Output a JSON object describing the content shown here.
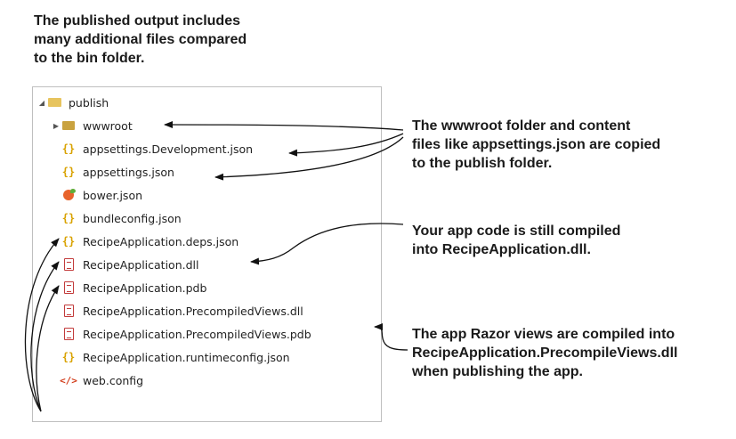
{
  "callouts": {
    "top": "The published output includes\nmany additional files compared\nto the bin folder.",
    "wwwroot": "The wwwroot folder and content\nfiles like appsettings.json are copied\nto the publish folder.",
    "app_code": "Your app code is still compiled\ninto RecipeApplication.dll.",
    "razor": "The app Razor views are compiled into\nRecipeApplication.PrecompileViews.dll\nwhen publishing the app."
  },
  "tree": {
    "root": {
      "label": "publish",
      "icon": "folder-open-icon",
      "toggle": "expanded"
    },
    "items": [
      {
        "label": "wwwroot",
        "icon": "folder-icon",
        "toggle": "collapsed"
      },
      {
        "label": "appsettings.Development.json",
        "icon": "json-icon"
      },
      {
        "label": "appsettings.json",
        "icon": "json-icon"
      },
      {
        "label": "bower.json",
        "icon": "bower-icon"
      },
      {
        "label": "bundleconfig.json",
        "icon": "json-icon"
      },
      {
        "label": "RecipeApplication.deps.json",
        "icon": "json-icon"
      },
      {
        "label": "RecipeApplication.dll",
        "icon": "dll-icon"
      },
      {
        "label": "RecipeApplication.pdb",
        "icon": "pdb-icon"
      },
      {
        "label": "RecipeApplication.PrecompiledViews.dll",
        "icon": "dll-icon"
      },
      {
        "label": "RecipeApplication.PrecompiledViews.pdb",
        "icon": "pdb-icon"
      },
      {
        "label": "RecipeApplication.runtimeconfig.json",
        "icon": "json-icon"
      },
      {
        "label": "web.config",
        "icon": "config-icon"
      }
    ]
  },
  "colors": {
    "json": "#d9a200",
    "folder": "#c9a23f",
    "dll": "#c23b3b",
    "config": "#d23c1a",
    "border": "#bfbfbf"
  }
}
